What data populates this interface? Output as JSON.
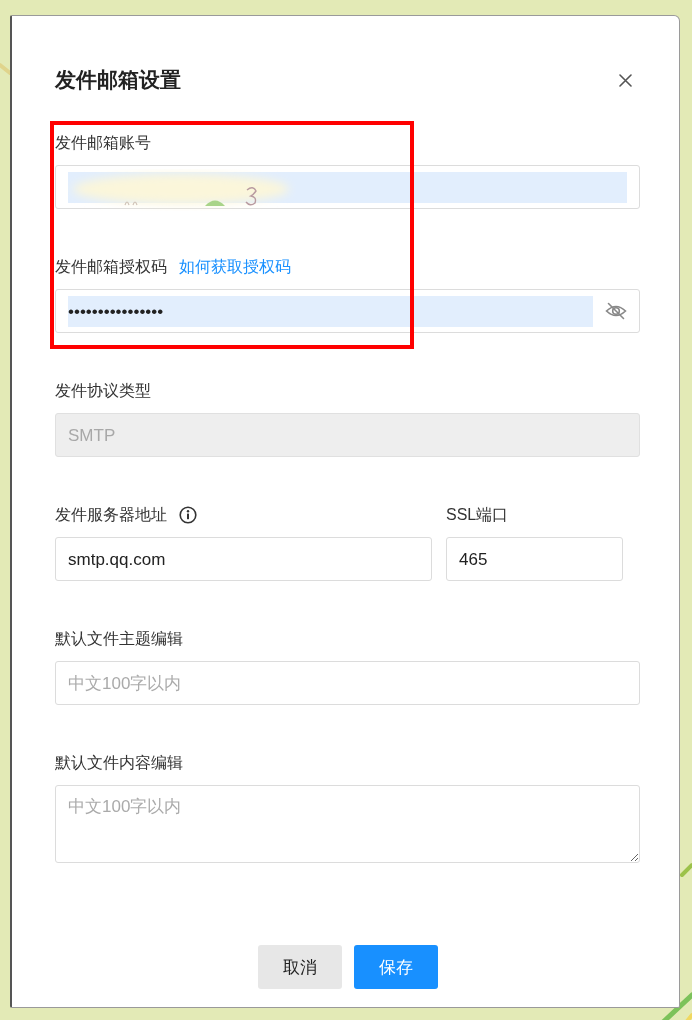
{
  "dialog": {
    "title": "发件邮箱设置",
    "fields": [
      {
        "kind": "input",
        "label": "发件邮箱账号",
        "autofilled": true,
        "obscured": true,
        "disabled": false,
        "highlighted": true
      },
      {
        "kind": "password",
        "label": "发件邮箱授权码",
        "link": "如何获取授权码",
        "value": "••••••••••••••••",
        "autofilled": true,
        "disabled": false,
        "show_password": false,
        "highlighted": true
      },
      {
        "kind": "input",
        "label": "发件协议类型",
        "value": "SMTP",
        "autofilled": false,
        "disabled": true,
        "highlighted": false
      },
      {
        "kind": "pair",
        "highlighted": false,
        "items": [
          {
            "label": "发件服务器地址",
            "info_icon": true,
            "value": "smtp.qq.com",
            "autofilled": false,
            "disabled": false
          },
          {
            "label": "SSL端口",
            "info_icon": false,
            "value": "465",
            "autofilled": false,
            "disabled": false
          }
        ]
      },
      {
        "kind": "input",
        "label": "默认文件主题编辑",
        "placeholder": "中文100字以内",
        "autofilled": false,
        "disabled": false,
        "highlighted": false
      },
      {
        "kind": "textarea",
        "label": "默认文件内容编辑",
        "placeholder": "中文100字以内",
        "highlighted": false
      }
    ],
    "buttons": [
      {
        "label": "取消",
        "kind": "secondary"
      },
      {
        "label": "保存",
        "kind": "primary"
      }
    ]
  }
}
